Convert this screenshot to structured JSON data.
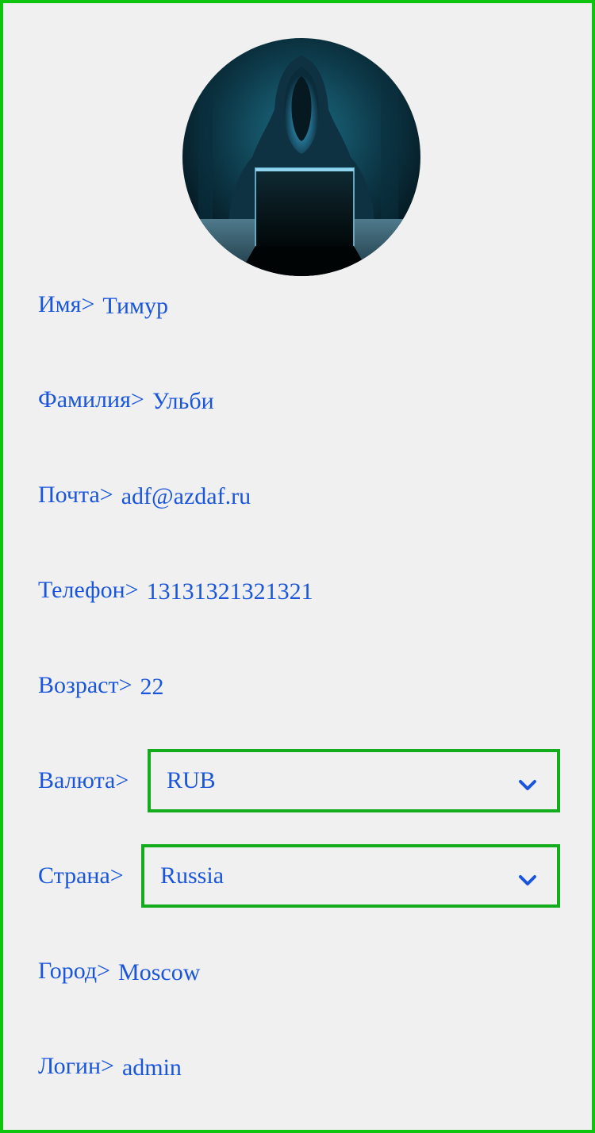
{
  "profile": {
    "avatar_icon": "hacker-avatar",
    "fields": {
      "first_name": {
        "label": "Имя",
        "value": "Тимур"
      },
      "last_name": {
        "label": "Фамилия",
        "value": "Ульби"
      },
      "email": {
        "label": "Почта",
        "value": "adf@azdaf.ru"
      },
      "phone": {
        "label": "Телефон",
        "value": "13131321321321"
      },
      "age": {
        "label": "Возраст",
        "value": "22"
      },
      "currency": {
        "label": "Валюта",
        "value": "RUB"
      },
      "country": {
        "label": "Страна",
        "value": "Russia"
      },
      "city": {
        "label": "Город",
        "value": "Moscow"
      },
      "login": {
        "label": "Логин",
        "value": "admin"
      }
    },
    "separator": ">"
  },
  "colors": {
    "text": "#1a56db",
    "frame_border": "#0ec40e",
    "select_border": "#12ac1c",
    "background": "#f0f0f0"
  }
}
